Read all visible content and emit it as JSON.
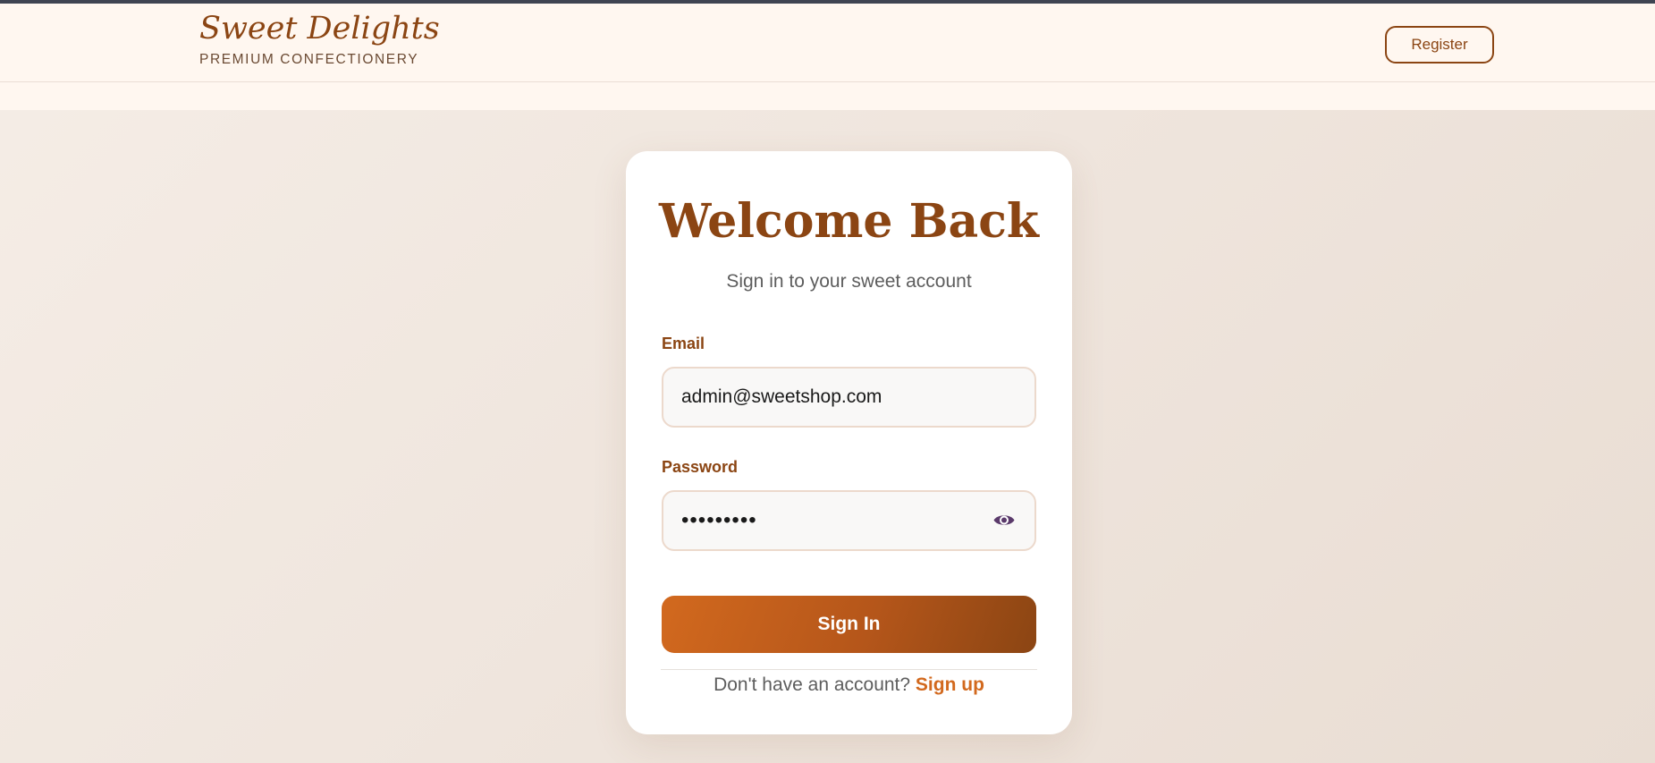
{
  "header": {
    "brand_title": "Sweet Delights",
    "brand_subtitle": "PREMIUM CONFECTIONERY",
    "register_label": "Register"
  },
  "login": {
    "title": "Welcome Back",
    "subtitle": "Sign in to your sweet account",
    "email_label": "Email",
    "email_value": "admin@sweetshop.com",
    "password_label": "Password",
    "password_value": "•••••••••",
    "password_toggle_icon": "eye-icon",
    "submit_label": "Sign In",
    "signup_prompt": "Don't have an account?",
    "signup_link": "Sign up"
  },
  "colors": {
    "brand": "#8b4513",
    "accent": "#d2691e",
    "header_bg": "#fff7f0",
    "eye_icon": "#5b3a6b"
  }
}
